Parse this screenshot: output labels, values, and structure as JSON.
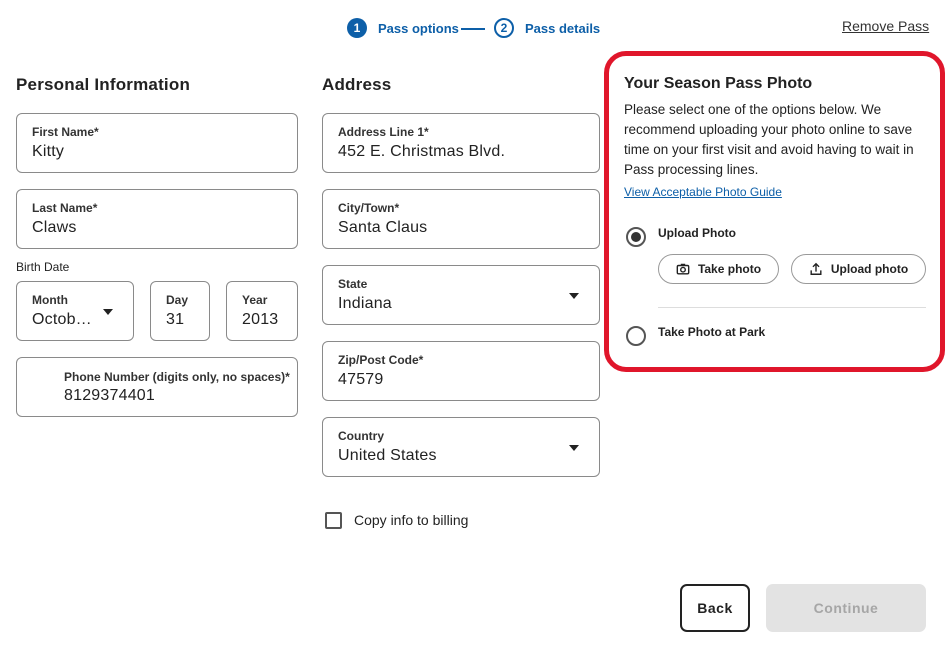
{
  "stepper": {
    "steps": [
      {
        "number": "1",
        "label": "Pass options",
        "state": "active"
      },
      {
        "number": "2",
        "label": "Pass details",
        "state": "upcoming"
      }
    ]
  },
  "header": {
    "remove_pass": "Remove Pass"
  },
  "personal": {
    "title": "Personal Information",
    "first_name": {
      "label": "First Name*",
      "value": "Kitty"
    },
    "last_name": {
      "label": "Last Name*",
      "value": "Claws"
    },
    "birth_date": {
      "label": "Birth Date",
      "month": {
        "label": "Month",
        "value": "Octob…"
      },
      "day": {
        "label": "Day",
        "value": "31"
      },
      "year": {
        "label": "Year",
        "value": "2013"
      }
    },
    "phone": {
      "label": "Phone Number (digits only, no spaces)*",
      "value": "8129374401"
    }
  },
  "address": {
    "title": "Address",
    "line1": {
      "label": "Address Line 1*",
      "value": "452 E. Christmas Blvd."
    },
    "city": {
      "label": "City/Town*",
      "value": "Santa Claus"
    },
    "state": {
      "label": "State",
      "value": "Indiana"
    },
    "zip": {
      "label": "Zip/Post Code*",
      "value": "47579"
    },
    "country": {
      "label": "Country",
      "value": "United States"
    },
    "copy_billing": "Copy info to billing"
  },
  "photo": {
    "title": "Your Season Pass Photo",
    "description": "Please select one of the options below. We recommend uploading your photo online to save time on your first visit and avoid having to wait in Pass processing lines.",
    "guide_link": "View Acceptable Photo Guide",
    "upload_option": "Upload Photo",
    "take_photo_button": "Take photo",
    "upload_photo_button": "Upload photo",
    "park_option": "Take Photo at Park",
    "selected": "Upload Photo"
  },
  "footer": {
    "back": "Back",
    "continue": "Continue"
  },
  "colors": {
    "accent": "#0d5fa8",
    "highlight": "#e0162b",
    "disabled": "#e3e3e3"
  }
}
